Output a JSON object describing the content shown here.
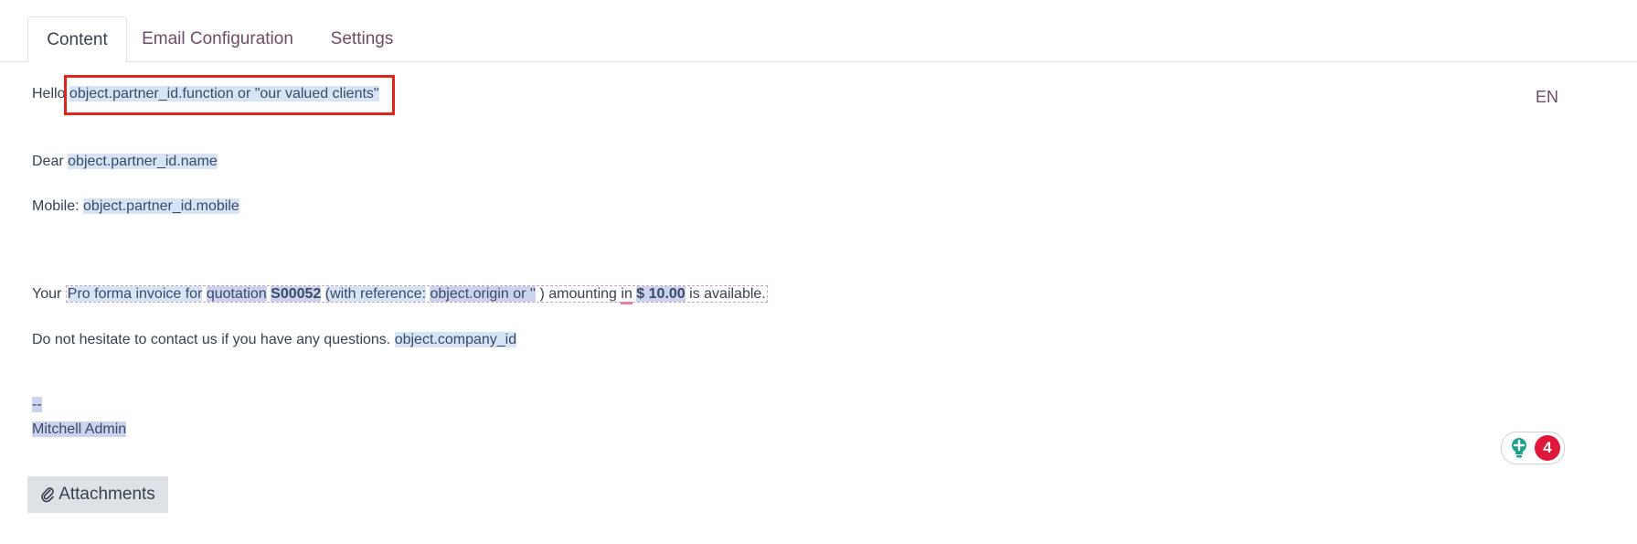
{
  "tabs": [
    {
      "label": "Content",
      "active": true
    },
    {
      "label": "Email Configuration",
      "active": false
    },
    {
      "label": "Settings",
      "active": false
    }
  ],
  "language": "EN",
  "body": {
    "greeting_prefix": "Hello",
    "greeting_field": "object.partner_id.function or \"our valued clients\"",
    "dear_prefix": "Dear",
    "dear_field": "object.partner_id.name",
    "mobile_prefix": "Mobile:",
    "mobile_field": "object.partner_id.mobile",
    "invoice_prefix": "Your",
    "invoice_doc": "Pro forma invoice for",
    "invoice_quotation": "quotation",
    "invoice_number": "S00052",
    "invoice_ref_open": "(with reference:",
    "invoice_ref_field": "object.origin or ''",
    "invoice_ref_close": ")",
    "invoice_amounting": "amounting",
    "invoice_in": "in",
    "invoice_amount": "$ 10.00",
    "invoice_suffix": "is available.",
    "contact_text": "Do not hesitate to contact us if you have any questions.",
    "contact_field": "object.company_id",
    "signature_sep": "--",
    "signature_name": "Mitchell Admin"
  },
  "attachments_label": "Attachments",
  "assistant": {
    "badge_count": "4",
    "colors": {
      "bulb": "#1aa38a",
      "badge": "#e0173b"
    }
  },
  "colors": {
    "accent": "#714b67",
    "highlight": "#e1251b",
    "placeholder_bg": "#d6e4f5"
  }
}
